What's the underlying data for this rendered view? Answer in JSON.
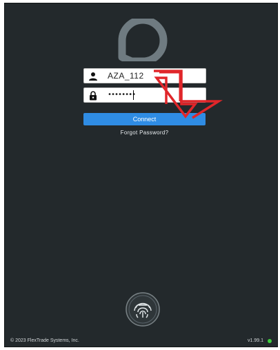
{
  "login": {
    "username_value": "AZA_112",
    "password_mask": "••••••••",
    "connect_label": "Connect",
    "forgot_label": "Forgot Password?"
  },
  "footer": {
    "copyright": "© 2023 FlexTrade Systems, Inc.",
    "version": "v1.99.1"
  },
  "colors": {
    "background": "#23292c",
    "accent": "#2f8ce4",
    "status_online": "#3ecf3e",
    "annotation_arrow": "#e0262a"
  },
  "icons": [
    "app-logo-icon",
    "user-icon",
    "lock-icon",
    "fingerprint-icon",
    "status-dot"
  ]
}
